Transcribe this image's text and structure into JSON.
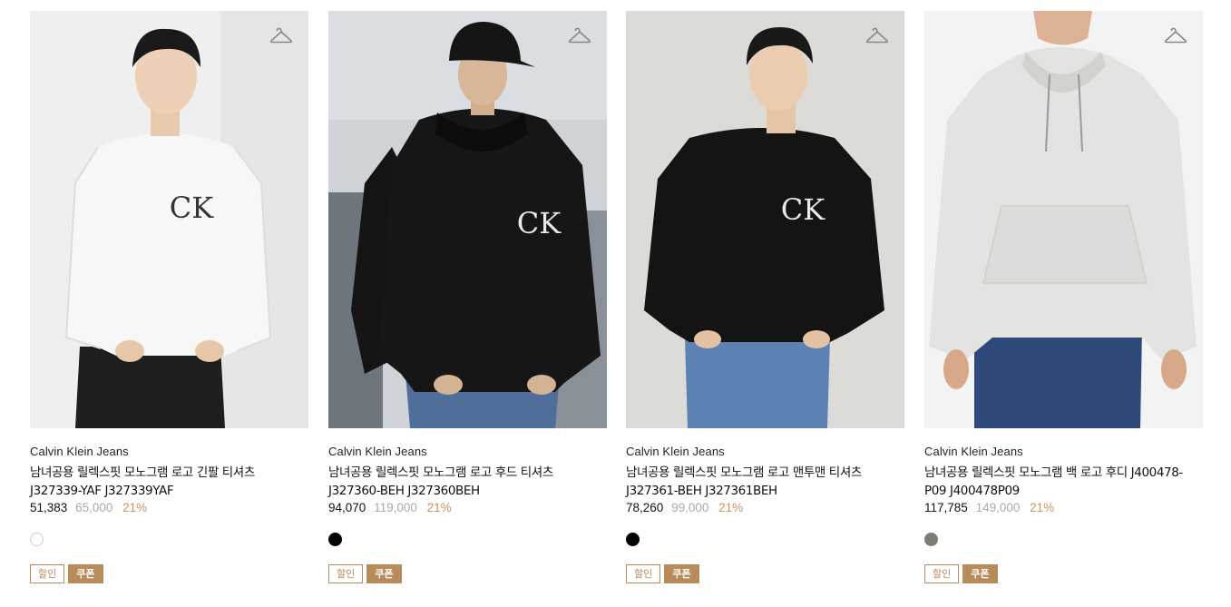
{
  "products": [
    {
      "brand": "Calvin Klein Jeans",
      "name": "남녀공용 릴렉스핏 모노그램 로고 긴팔 티셔츠 J327339-YAF J327339YAF",
      "price": "51,383",
      "original_price": "65,000",
      "discount": "21%",
      "swatch_color": "#ffffff",
      "badges": {
        "sale": "할인",
        "coupon": "쿠폰"
      }
    },
    {
      "brand": "Calvin Klein Jeans",
      "name": "남녀공용 릴렉스핏 모노그램 로고 후드 티셔츠 J327360-BEH J327360BEH",
      "price": "94,070",
      "original_price": "119,000",
      "discount": "21%",
      "swatch_color": "#000000",
      "badges": {
        "sale": "할인",
        "coupon": "쿠폰"
      }
    },
    {
      "brand": "Calvin Klein Jeans",
      "name": "남녀공용 릴렉스핏 모노그램 로고 맨투맨 티셔츠 J327361-BEH J327361BEH",
      "price": "78,260",
      "original_price": "99,000",
      "discount": "21%",
      "swatch_color": "#000000",
      "badges": {
        "sale": "할인",
        "coupon": "쿠폰"
      }
    },
    {
      "brand": "Calvin Klein Jeans",
      "name": "남녀공용 릴렉스핏 모노그램 백 로고 후디 J400478-P09 J400478P09",
      "price": "117,785",
      "original_price": "149,000",
      "discount": "21%",
      "swatch_color": "#7d7d72",
      "badges": {
        "sale": "할인",
        "coupon": "쿠폰"
      }
    }
  ],
  "colors": {
    "accent": "#b98b5b",
    "discount_text": "#c9935e"
  },
  "icons": {
    "wishlist": "hanger-icon"
  }
}
